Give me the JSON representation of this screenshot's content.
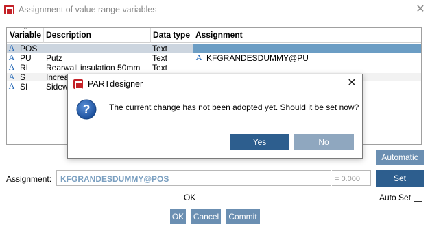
{
  "window": {
    "title": "Assignment of value range variables",
    "close_glyph": "✕"
  },
  "table": {
    "headers": [
      "Variable",
      "Description",
      "Data type",
      "Assignment"
    ],
    "rows": [
      {
        "variable": "POS",
        "description": "",
        "type": "Text",
        "assignment": "",
        "icon": "A"
      },
      {
        "variable": "PU",
        "description": "Putz",
        "type": "Text",
        "assignment": "KFGRANDESDUMMY@PU",
        "icon": "A"
      },
      {
        "variable": "RI",
        "description": "Rearwall insulation 50mm",
        "type": "Text",
        "assignment": "",
        "icon": "A"
      },
      {
        "variable": "S",
        "description": "Increa",
        "type": "",
        "assignment": "",
        "icon": "A"
      },
      {
        "variable": "SI",
        "description": "Sidew",
        "type": "",
        "assignment": "",
        "icon": "A"
      }
    ]
  },
  "buttons": {
    "automatic": "Automatic",
    "set": "Set",
    "ok": "OK",
    "cancel": "Cancel",
    "commit": "Commit"
  },
  "assignment": {
    "label": "Assignment:",
    "value": "KFGRANDESDUMMY@POS",
    "result": "= 0.000"
  },
  "status_text": "OK",
  "auto_set_label": "Auto Set",
  "dialog": {
    "title": "PARTdesigner",
    "message": "The current change has not been adopted yet. Should it be set now?",
    "yes": "Yes",
    "no": "No",
    "close_glyph": "✕"
  },
  "colors": {
    "accent": "#2d5e8e",
    "button": "#6b8fb2",
    "selection": "#6b9dc4",
    "brand": "#c42127"
  },
  "icons": [
    "app-logo-icon",
    "close-icon",
    "text-type-icon",
    "question-icon"
  ]
}
